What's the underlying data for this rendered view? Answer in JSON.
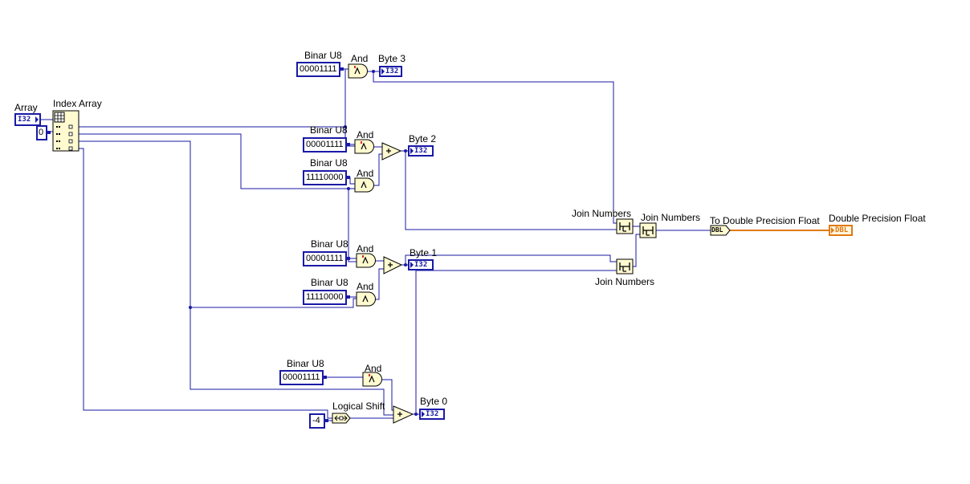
{
  "array_control": {
    "label": "Array",
    "type_tag": "I32"
  },
  "index_array": {
    "label": "Index Array",
    "index_const": "0"
  },
  "byte3": {
    "const_label": "Binar U8",
    "const_value": "00001111",
    "and_label": "And",
    "ind_label": "Byte 3",
    "ind_type": "I32"
  },
  "byte2": {
    "const1_label": "Binar U8",
    "const1_value": "00001111",
    "and1_label": "And",
    "const2_label": "Binar U8",
    "const2_value": "11110000",
    "and2_label": "And",
    "ind_label": "Byte 2",
    "ind_type": "I32"
  },
  "byte1": {
    "const1_label": "Binar U8",
    "const1_value": "00001111",
    "and1_label": "And",
    "const2_label": "Binar U8",
    "const2_value": "11110000",
    "and2_label": "And",
    "ind_label": "Byte 1",
    "ind_type": "I32"
  },
  "byte0": {
    "const_label": "Binar U8",
    "const_value": "00001111",
    "and_label": "And",
    "shift_label": "Logical Shift",
    "shift_const": "-4",
    "ind_label": "Byte 0",
    "ind_type": "I32"
  },
  "join_numbers": {
    "upper_label": "Join Numbers",
    "lower_label": "Join Numbers",
    "final_label": "Join Numbers"
  },
  "to_double": {
    "label": "To Double Precision Float",
    "type_tag": "DBL"
  },
  "output": {
    "label": "Double Precision Float",
    "type_tag": "DBL"
  },
  "colors": {
    "wire_int": "#1a1aa6",
    "wire_dbl": "#e07a10",
    "node_fill": "#fffad0"
  }
}
